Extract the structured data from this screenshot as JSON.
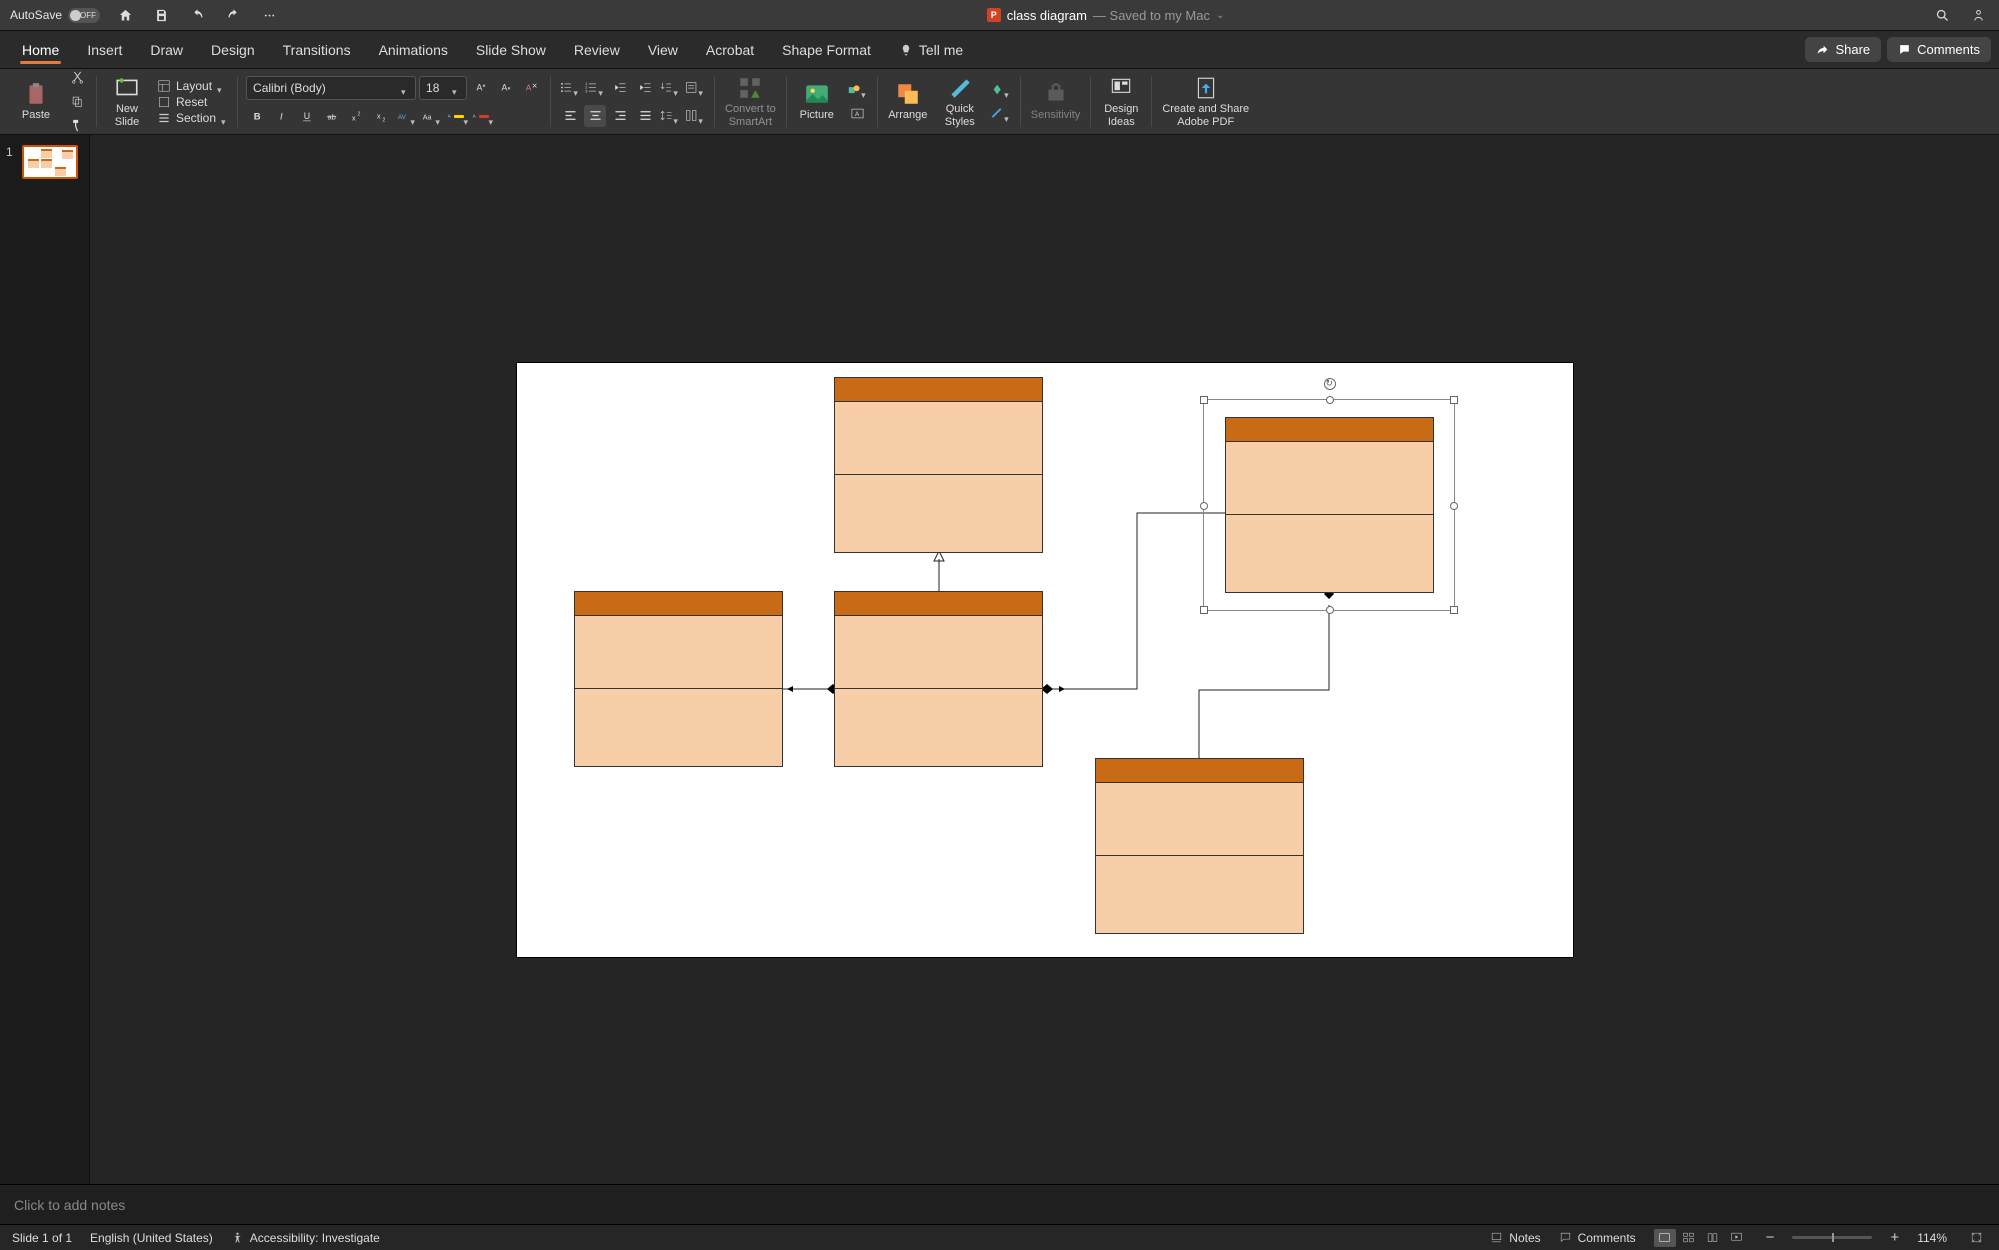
{
  "titlebar": {
    "autosave_label": "AutoSave",
    "autosave_state": "OFF",
    "doc_title": "class diagram",
    "doc_status": "— Saved to my Mac"
  },
  "tabs": {
    "items": [
      "Home",
      "Insert",
      "Draw",
      "Design",
      "Transitions",
      "Animations",
      "Slide Show",
      "Review",
      "View",
      "Acrobat",
      "Shape Format"
    ],
    "active": "Home",
    "tell_me": "Tell me",
    "share": "Share",
    "comments": "Comments"
  },
  "ribbon": {
    "paste": "Paste",
    "new_slide": "New\nSlide",
    "layout": "Layout",
    "reset": "Reset",
    "section": "Section",
    "font_name": "Calibri (Body)",
    "font_size": "18",
    "convert": "Convert to\nSmartArt",
    "picture": "Picture",
    "arrange": "Arrange",
    "quick_styles": "Quick\nStyles",
    "sensitivity": "Sensitivity",
    "design_ideas": "Design\nIdeas",
    "create_pdf": "Create and Share\nAdobe PDF"
  },
  "thumbnails": {
    "slides": [
      {
        "num": "1"
      }
    ]
  },
  "notes": {
    "placeholder": "Click to add notes"
  },
  "status": {
    "slide_count": "Slide 1 of 1",
    "language": "English (United States)",
    "accessibility": "Accessibility: Investigate",
    "notes": "Notes",
    "comments": "Comments",
    "zoom": "114%"
  },
  "colors": {
    "shape_header": "#c96a17",
    "shape_body": "#f7cea7",
    "accent": "#d35400"
  }
}
